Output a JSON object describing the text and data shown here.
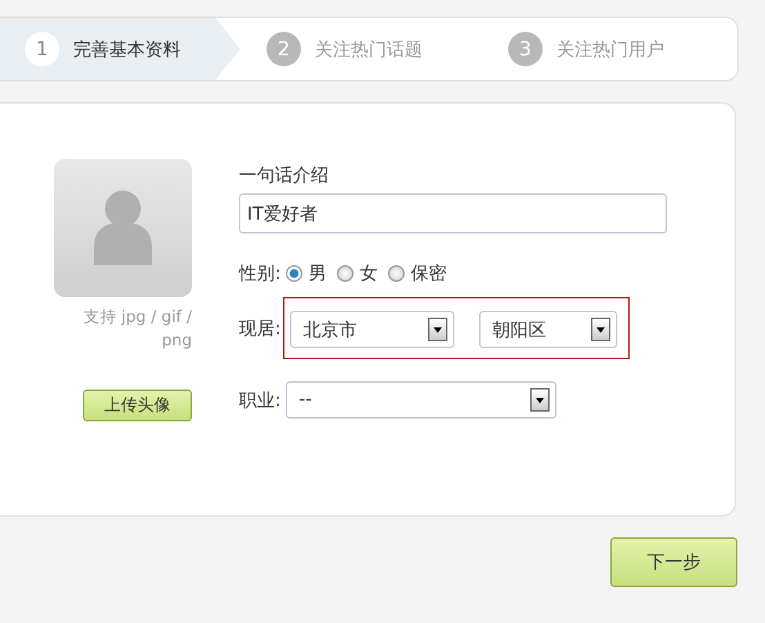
{
  "steps": [
    {
      "number": "1",
      "label": "完善基本资料",
      "selected": true
    },
    {
      "number": "2",
      "label": "关注热门话题",
      "selected": false
    },
    {
      "number": "3",
      "label": "关注热门用户",
      "selected": false
    }
  ],
  "avatar": {
    "caption": "支持 jpg / gif / png",
    "upload_button": "上传头像"
  },
  "bio": {
    "label": "一句话介绍",
    "value": "IT爱好者"
  },
  "gender": {
    "label": "性别:",
    "options": [
      {
        "label": "男",
        "selected": true
      },
      {
        "label": "女",
        "selected": false
      },
      {
        "label": "保密",
        "selected": false
      }
    ]
  },
  "residence": {
    "label": "现居:",
    "highlighted": true,
    "selects": [
      {
        "value": "北京市"
      },
      {
        "value": "朝阳区"
      }
    ]
  },
  "occupation": {
    "label": "职业:",
    "value": "--"
  },
  "next_button": "下一步"
}
